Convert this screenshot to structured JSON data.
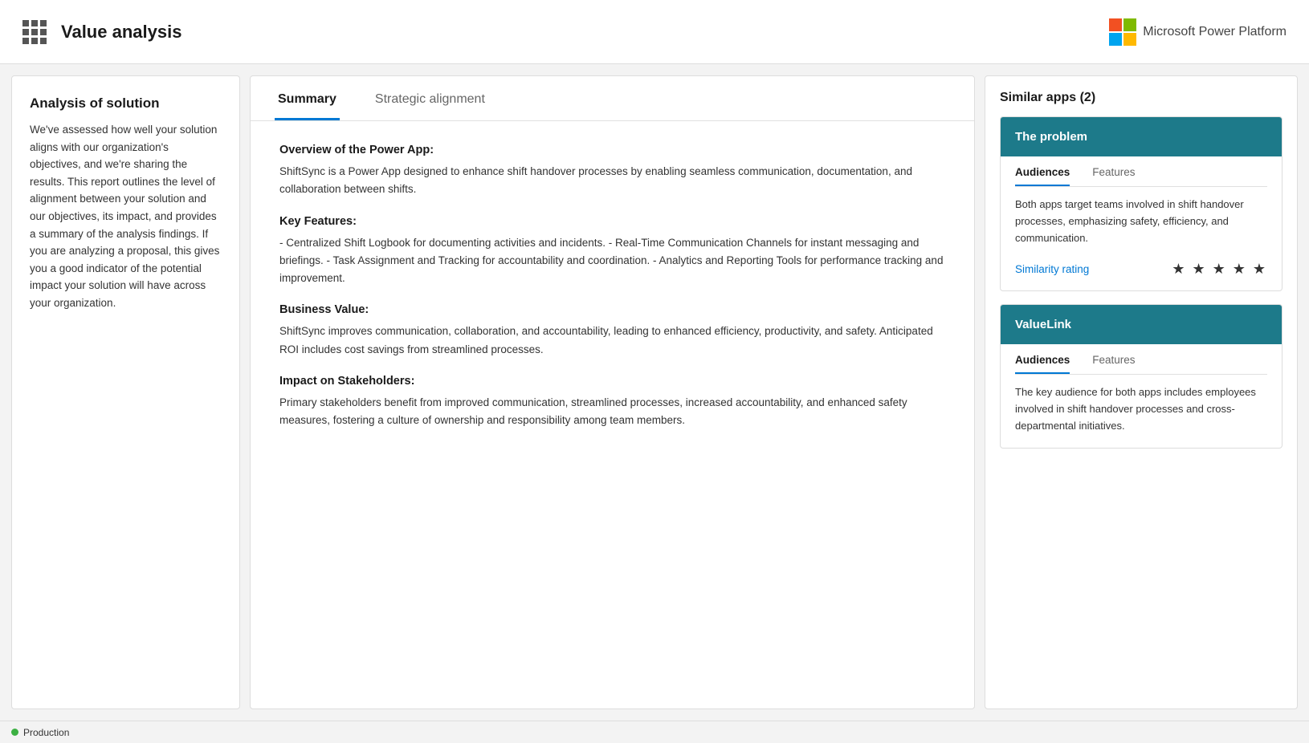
{
  "nav": {
    "title": "Value analysis",
    "ms_label": "Microsoft Power Platform"
  },
  "left_panel": {
    "title": "Analysis of solution",
    "body": "We've assessed how well your solution aligns with our organization's objectives, and we're sharing the results. This report outlines the level of alignment between your solution and our objectives, its impact, and provides a summary of the analysis findings. If you are analyzing a proposal, this gives you a good indicator of the potential impact your solution will have across your organization."
  },
  "center": {
    "tabs": [
      {
        "label": "Summary",
        "active": true
      },
      {
        "label": "Strategic alignment",
        "active": false
      }
    ],
    "sections": [
      {
        "heading": "Overview of the Power App:",
        "body": "ShiftSync is a Power App designed to enhance shift handover processes by enabling seamless communication, documentation, and collaboration between shifts."
      },
      {
        "heading": "Key Features:",
        "body": "- Centralized Shift Logbook for documenting activities and incidents. - Real-Time Communication Channels for instant messaging and briefings. - Task Assignment and Tracking for accountability and coordination. - Analytics and Reporting Tools for performance tracking and improvement."
      },
      {
        "heading": "Business Value:",
        "body": "ShiftSync improves communication, collaboration, and accountability, leading to enhanced efficiency, productivity, and safety. Anticipated ROI includes cost savings from streamlined processes."
      },
      {
        "heading": "Impact on Stakeholders:",
        "body": "Primary stakeholders benefit from improved communication, streamlined processes, increased accountability, and enhanced safety measures, fostering a culture of ownership and responsibility among team members."
      }
    ]
  },
  "right_panel": {
    "title": "Similar apps (2)",
    "apps": [
      {
        "name": "The problem",
        "tabs": [
          "Audiences",
          "Features"
        ],
        "active_tab": "Audiences",
        "audiences_text": "Both apps target teams involved in shift handover processes, emphasizing safety, efficiency, and communication.",
        "similarity_label": "Similarity rating",
        "stars": "★ ★ ★ ★ ★"
      },
      {
        "name": "ValueLink",
        "tabs": [
          "Audiences",
          "Features"
        ],
        "active_tab": "Audiences",
        "audiences_text": "The key audience for both apps includes employees involved in shift handover processes and cross-departmental initiatives.",
        "similarity_label": "",
        "stars": ""
      }
    ]
  },
  "status": {
    "label": "Production"
  }
}
